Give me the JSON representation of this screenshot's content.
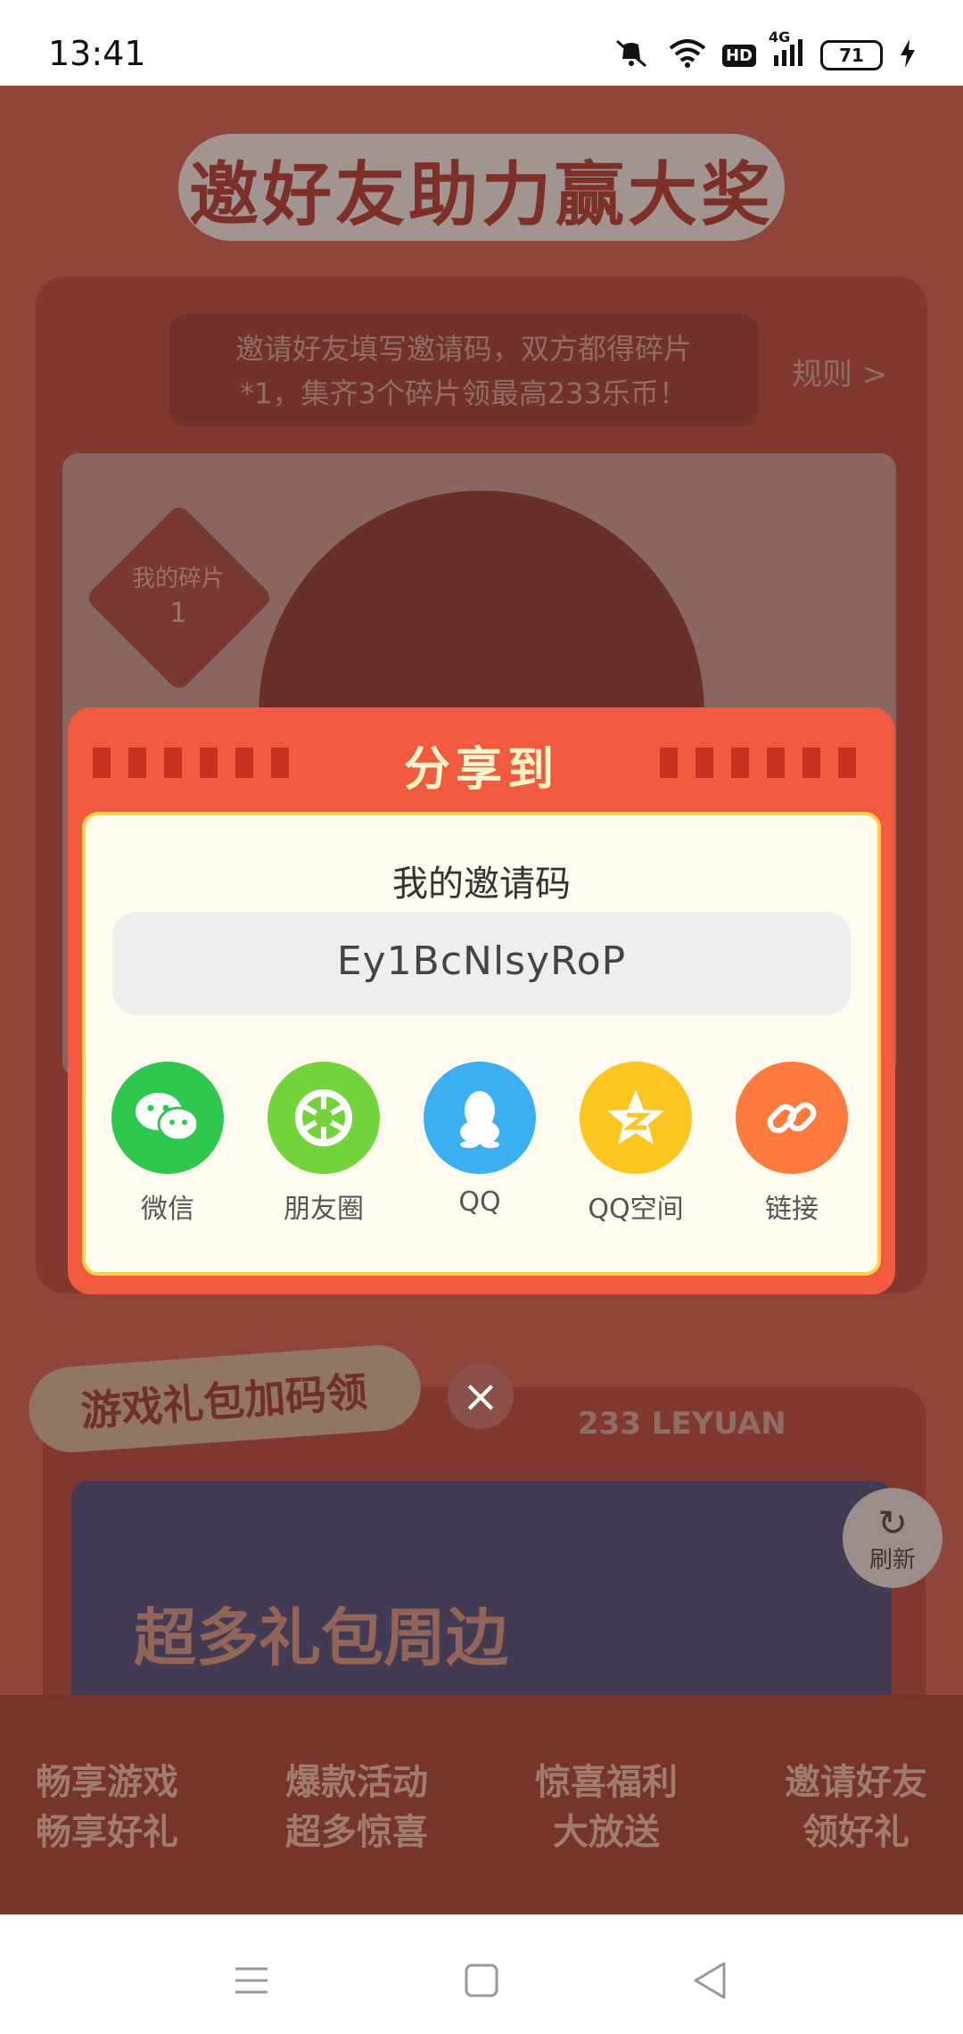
{
  "status_bar": {
    "time": "13:41",
    "hd_badge": "HD",
    "network": "4G",
    "battery": "71"
  },
  "page": {
    "title": "邀好友助力赢大奖",
    "description_line1": "邀请好友填写邀请码，双方都得碎片",
    "description_line2": "*1，集齐3个碎片领最高233乐币！",
    "rules_link": "规则 >",
    "fragments_label": "我的碎片",
    "fragments_count": "1",
    "gift_section_title": "游戏礼包加码领",
    "brand_text": "233 LEYUAN",
    "banner_text": "超多礼包周边",
    "refresh_label": "刷新",
    "bottom_items": [
      {
        "line1": "畅享游戏",
        "line2": "畅享好礼"
      },
      {
        "line1": "爆款活动",
        "line2": "超多惊喜"
      },
      {
        "line1": "惊喜福利",
        "line2": "大放送"
      },
      {
        "line1": "邀请好友",
        "line2": "领好礼"
      }
    ]
  },
  "share_modal": {
    "title": "分享到",
    "invite_label": "我的邀请码",
    "invite_code": "Ey1BcNlsyRoP",
    "options": [
      {
        "label": "微信",
        "icon": "wechat-icon",
        "color": "#2dc84d"
      },
      {
        "label": "朋友圈",
        "icon": "moments-icon",
        "color": "#72d43a"
      },
      {
        "label": "QQ",
        "icon": "qq-icon",
        "color": "#3ab0f2"
      },
      {
        "label": "QQ空间",
        "icon": "qzone-icon",
        "color": "#fdc51f"
      },
      {
        "label": "链接",
        "icon": "link-icon",
        "color": "#ff7a3d"
      }
    ],
    "close": "×"
  },
  "colors": {
    "modal_header": "#f25a3f",
    "modal_border": "#ffcf4a"
  }
}
